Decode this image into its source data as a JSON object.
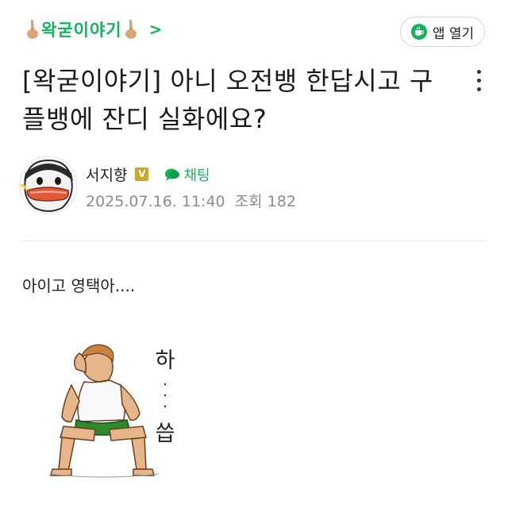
{
  "cafe": {
    "name": "왁굳이야기",
    "arrow": ">"
  },
  "header": {
    "open_app_label": "앱 열기"
  },
  "post": {
    "title": "[왁굳이야기] 아니 오전뱅 한답시고 구플뱅에 잔디 실화에요?",
    "author": "서지향",
    "badge": "V",
    "chat_label": "채팅",
    "date": "2025.07.16. 11:40",
    "views_label": "조회",
    "views": "182",
    "body": "아이고 영택아....",
    "sfx_top": "하",
    "sfx_dots": "·\n·\n·",
    "sfx_bottom": "씁"
  },
  "colors": {
    "accent": "#13b35c",
    "badge": "#c9a72c"
  },
  "icons": [
    "hand-icon",
    "cup-icon",
    "more-vertical-icon",
    "chat-bubble-icon"
  ]
}
